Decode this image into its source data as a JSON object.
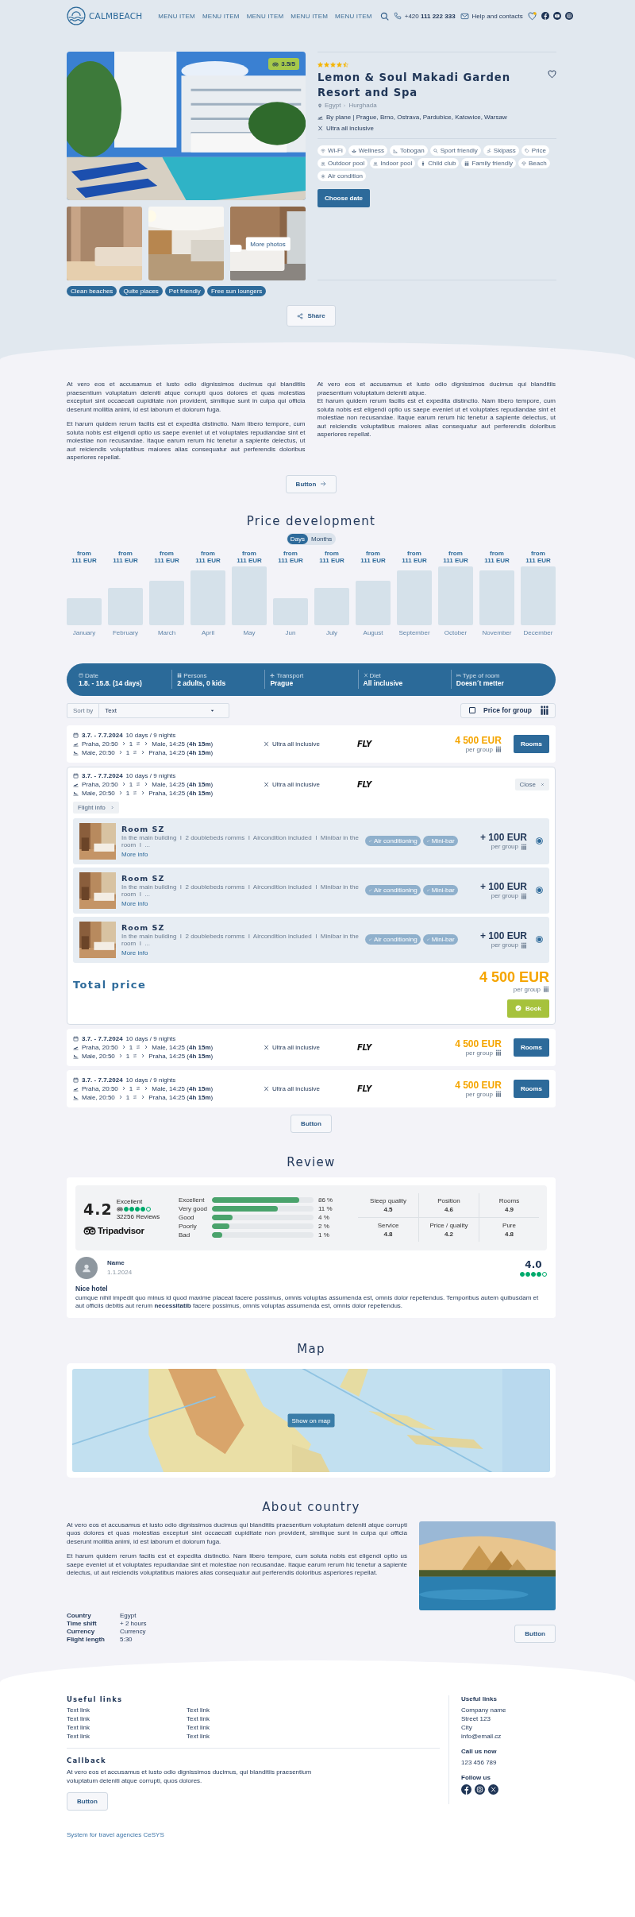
{
  "header": {
    "logo": "CALMBEACH",
    "menu": [
      "MENU ITEM",
      "MENU ITEM",
      "MENU ITEM",
      "MENU ITEM",
      "MENU ITEM"
    ],
    "phone": "+420 **111 222 333**",
    "help": "Help and contacts"
  },
  "hotel": {
    "rating_badge": "3.5/5",
    "stars": 4.5,
    "name": "Lemon & Soul Makadi Garden Resort and Spa",
    "country": "Egypt",
    "city": "Hurghada",
    "transport": "By plane | Prague, Brno, Ostrava, Pardubice, Katowice, Warsaw",
    "board": "Ultra all inclusive",
    "amenities": [
      {
        "label": "Wi-Fi",
        "kind": "wifi"
      },
      {
        "label": "Wellness",
        "kind": "wellness"
      },
      {
        "label": "Tobogan",
        "kind": "slide"
      },
      {
        "label": "Sport friendly",
        "kind": "sport"
      },
      {
        "label": "Skipass",
        "kind": "ski"
      },
      {
        "label": "Price",
        "kind": "tag"
      },
      {
        "label": "Outdoor pool",
        "kind": "pool"
      },
      {
        "label": "Indoor pool",
        "kind": "pool"
      },
      {
        "label": "Child club",
        "kind": "kids"
      },
      {
        "label": "Family friendly",
        "kind": "family"
      },
      {
        "label": "Beach",
        "kind": "beach"
      },
      {
        "label": "Air condition",
        "kind": "ac"
      }
    ],
    "choose_date": "Choose date",
    "more_photos": "More photos",
    "tags": [
      "Clean beaches",
      "Quite places",
      "Pet friendly",
      "Free sun loungers"
    ],
    "share": "Share"
  },
  "intro": {
    "columns": [
      [
        "At vero eos et accusamus et iusto odio dignissimos ducimus qui blanditiis praesentium voluptatum deleniti atque corrupti quos dolores et quas molestias excepturi sint occaecati cupiditate non provident, similique sunt in culpa qui officia deserunt mollitia animi, id est laborum et dolorum fuga.",
        "Et harum quidem rerum facilis est et expedita distinctio. Nam libero tempore, cum soluta nobis est eligendi optio us saepe eveniet ut et voluptates repudiandae sint et molestiae non recusandae. Itaque earum rerum hic tenetur a sapiente delectus, ut aut reiciendis voluptatibus maiores alias consequatur aut perferendis doloribus asperiores repellat."
      ],
      [
        "At vero eos et accusamus et iusto odio dignissimos ducimus qui blanditiis praesentium voluptatum deleniti atque.\nEt harum quidem rerum facilis est et expedita distinctio. Nam libero tempore, cum soluta nobis est eligendi optio us saepe eveniet ut et voluptates repudiandae sint et molestiae non recusandae. Itaque earum rerum hic tenetur a sapiente delectus, ut aut reiciendis voluptatibus maiores alias consequatur aut perferendis doloribus asperiores repellat."
      ]
    ],
    "button": "Button"
  },
  "price_development": {
    "title": "Price development",
    "toggle": [
      {
        "label": "Days",
        "selected": true
      },
      {
        "label": "Months",
        "selected": false
      }
    ],
    "bars": [
      {
        "from": "from",
        "price": "111 EUR",
        "month": "January"
      },
      {
        "from": "from",
        "price": "111 EUR",
        "month": "February"
      },
      {
        "from": "from",
        "price": "111 EUR",
        "month": "March"
      },
      {
        "from": "from",
        "price": "111 EUR",
        "month": "April"
      },
      {
        "from": "from",
        "price": "111 EUR",
        "month": "May"
      },
      {
        "from": "from",
        "price": "111 EUR",
        "month": "Jun"
      },
      {
        "from": "from",
        "price": "111 EUR",
        "month": "July"
      },
      {
        "from": "from",
        "price": "111 EUR",
        "month": "August"
      },
      {
        "from": "from",
        "price": "111 EUR",
        "month": "September"
      },
      {
        "from": "from",
        "price": "111 EUR",
        "month": "October"
      },
      {
        "from": "from",
        "price": "111 EUR",
        "month": "November"
      },
      {
        "from": "from",
        "price": "111 EUR",
        "month": "December"
      }
    ]
  },
  "search_bar": [
    {
      "label": "Date",
      "value": "1.8. - 15.8. (14 days)",
      "kind": "calendar"
    },
    {
      "label": "Persons",
      "value": "2 adults, 0 kids",
      "kind": "persons"
    },
    {
      "label": "Transport",
      "value": "Prague",
      "kind": "plane"
    },
    {
      "label": "Diet",
      "value": "All inclusive",
      "kind": "cutlery"
    },
    {
      "label": "Type of room",
      "value": "Doesn´t metter",
      "kind": "bed"
    }
  ],
  "sort": {
    "label": "Sort by",
    "value": "Text"
  },
  "price_for_group": {
    "label": "Price for group",
    "checked": false
  },
  "offers": [
    {
      "kind": "collapsed",
      "dates": "3.7. - 7.7.2024",
      "duration": "10 days / 9 nights",
      "outbound": {
        "from": "Praha, 20:50",
        "stops": "1",
        "to": "Male, 14:25 (**4h 15m**)"
      },
      "return": {
        "from": "Male, 20:50",
        "stops": "1",
        "to": "Praha, 14:25 (**4h 15m**)"
      },
      "board": "Ultra all inclusive",
      "airline": "FLY",
      "price": "4 500 EUR",
      "per": "per group",
      "button": "Rooms"
    },
    {
      "kind": "expanded",
      "dates": "3.7. - 7.7.2024",
      "duration": "10 days / 9 nights",
      "outbound": {
        "from": "Praha, 20:50",
        "stops": "1",
        "to": "Male, 14:25 (**4h 15m**)"
      },
      "return": {
        "from": "Male, 20:50",
        "stops": "1",
        "to": "Praha, 14:25 (**4h 15m**)"
      },
      "board": "Ultra all inclusive",
      "airline": "FLY",
      "close": "Close",
      "flight_info": "Flight info",
      "rooms": [
        {
          "name": "Room SZ",
          "description": "In the main building  I  2 doublebeds romms  I  Aircondition included  I  Minibar in the room  I  ...",
          "more": "More info",
          "features": [
            "Air conditioning",
            "Mini-bar"
          ],
          "price": "+ 100 EUR",
          "per": "per group",
          "selected": true
        },
        {
          "name": "Room SZ",
          "description": "In the main building  I  2 doublebeds romms  I  Aircondition included  I  Minibar in the room  I  ...",
          "more": "More info",
          "features": [
            "Air conditioning",
            "Mini-bar"
          ],
          "price": "+ 100 EUR",
          "per": "per group",
          "selected": true
        },
        {
          "name": "Room SZ",
          "description": "In the main building  I  2 doublebeds romms  I  Aircondition included  I  Minibar in the room  I  ...",
          "more": "More info",
          "features": [
            "Air conditioning",
            "Mini-bar"
          ],
          "price": "+ 100 EUR",
          "per": "per group",
          "selected": true
        }
      ],
      "total_label": "Total price",
      "total": "4 500 EUR",
      "total_per": "per group",
      "book": "Book"
    },
    {
      "kind": "collapsed",
      "dates": "3.7. - 7.7.2024",
      "duration": "10 days / 9 nights",
      "outbound": {
        "from": "Praha, 20:50",
        "stops": "1",
        "to": "Male, 14:25 (**4h 15m**)"
      },
      "return": {
        "from": "Male, 20:50",
        "stops": "1",
        "to": "Praha, 14:25 (**4h 15m**)"
      },
      "board": "Ultra all inclusive",
      "airline": "FLY",
      "price": "4 500 EUR",
      "per": "per group",
      "button": "Rooms"
    },
    {
      "kind": "collapsed",
      "dates": "3.7. - 7.7.2024",
      "duration": "10 days / 9 nights",
      "outbound": {
        "from": "Praha, 20:50",
        "stops": "1",
        "to": "Male, 14:25 (**4h 15m**)"
      },
      "return": {
        "from": "Male, 20:50",
        "stops": "1",
        "to": "Praha, 14:25 (**4h 15m**)"
      },
      "board": "Ultra all inclusive",
      "airline": "FLY",
      "price": "4 500 EUR",
      "per": "per group",
      "button": "Rooms"
    }
  ],
  "more_button": "Button",
  "review": {
    "title": "Review",
    "score": "4.2",
    "verdict": "Excellent",
    "stars": 4,
    "count": "32256 Reviews",
    "brand": "Tripadvisor",
    "distribution": [
      {
        "label": "Excellent",
        "level": 0.86,
        "reading": "86 %"
      },
      {
        "label": "Very good",
        "level": 0.65,
        "reading": "11 %"
      },
      {
        "label": "Good",
        "level": 0.2,
        "reading": "4 %"
      },
      {
        "label": "Poorly",
        "level": 0.17,
        "reading": "2 %"
      },
      {
        "label": "Bad",
        "level": 0.1,
        "reading": "1 %"
      }
    ],
    "categories": [
      {
        "label": "Sleep quality",
        "value": "4.5"
      },
      {
        "label": "Position",
        "value": "4.6"
      },
      {
        "label": "Rooms",
        "value": "4.9"
      },
      {
        "label": "Service",
        "value": "4.8"
      },
      {
        "label": "Price / quality",
        "value": "4.2"
      },
      {
        "label": "Pure",
        "value": "4.8"
      }
    ],
    "user": {
      "name": "Name",
      "date": "1.1.2024",
      "score": "4.0",
      "stars": 4,
      "title": "Nice hotel",
      "text": "cumque nihil impedit quo minus id quod maxime placeat facere possimus, omnis voluptas assumenda est, omnis dolor repellendus. Temporibus autem quibusdam et aut officiis debitis aut rerum **necessitatib** facere possimus, omnis voluptas assumenda est, omnis dolor repellendus."
    }
  },
  "map": {
    "title": "Map",
    "button": "Show on map"
  },
  "about": {
    "title": "About country",
    "paragraphs": [
      "At vero eos et accusamus et iusto odio dignissimos ducimus qui blanditiis praesentium voluptatum deleniti atque corrupti quos dolores et quas molestias excepturi sint occaecati cupiditate non provident, similique sunt in culpa qui officia deserunt mollitia animi, id est laborum et dolorum fuga.",
      "Et harum quidem rerum facilis est et expedita distinctio. Nam libero tempore, cum soluta nobis est eligendi optio us saepe eveniet ut et voluptates repudiandae sint et molestiae non recusandae. Itaque earum rerum hic tenetur a sapiente delectus, ut aut reiciendis voluptatibus maiores alias consequatur aut perferendis doloribus asperiores repellat."
    ],
    "facts": [
      {
        "label": "Country",
        "value": "Egypt"
      },
      {
        "label": "Time shift",
        "value": "+ 2 hours"
      },
      {
        "label": "Currency",
        "value": "Currency"
      },
      {
        "label": "Flight length",
        "value": "5:30"
      }
    ],
    "button": "Button"
  },
  "footer": {
    "links_title": "Useful links",
    "links": [
      "Text link",
      "Text link",
      "Text link",
      "Text link",
      "Text link",
      "Text link",
      "Text link",
      "Text link"
    ],
    "callback_title": "Callback",
    "callback_text": "At vero eos et accusamus et iusto odio dignissimos ducimus, qui blanditiis praesentium voluptatum deleniti atque corrupti, quos dolores.",
    "callback_button": "Button",
    "contact_title": "Useful links",
    "address": [
      "Company name",
      "Street 123",
      "City",
      "info@email.cz"
    ],
    "call_title": "Call us now",
    "phone": "123 456 789",
    "follow_title": "Follow us",
    "credit": "System for travel agencies CeSYS"
  }
}
